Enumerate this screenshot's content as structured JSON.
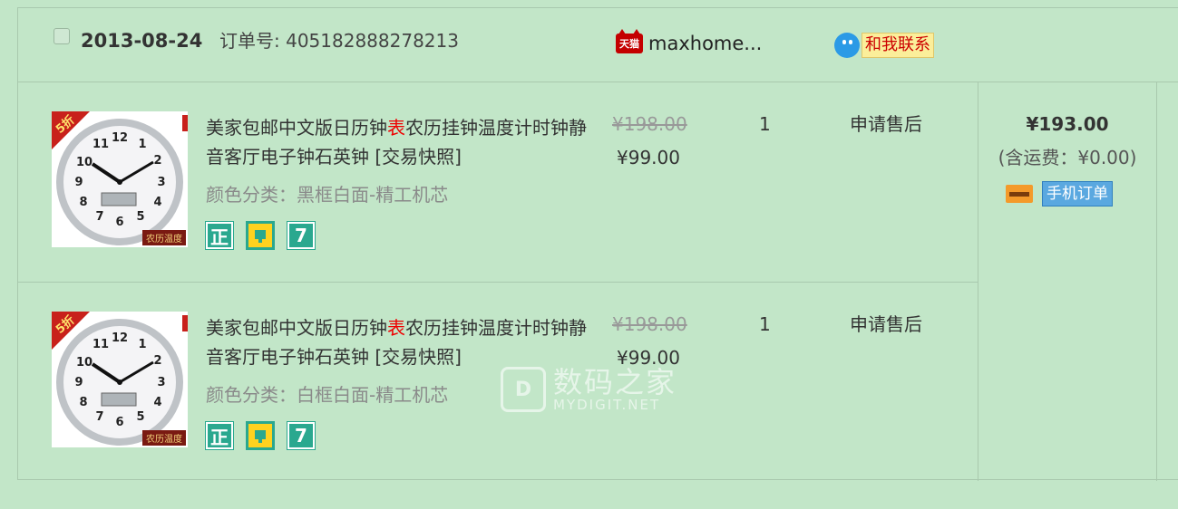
{
  "order": {
    "date": "2013-08-24",
    "order_number": "订单号: 405182888278213",
    "shop_badge": "天猫",
    "shop_name": "maxhome...",
    "contact_label": "和我联系"
  },
  "items": [
    {
      "discount_badge": "5折",
      "thumb_tag": "农历温度",
      "title_before": "美家包邮中文版日历钟",
      "title_highlight": "表",
      "title_after": "农历挂钟温度计时钟静音客厅电子钟石英钟 [交易快照]",
      "sku": "颜色分类：黑框白面-精工机芯",
      "icon1": "正",
      "icon3": "7",
      "original_price": "¥198.00",
      "price": "¥99.00",
      "quantity": "1",
      "after_sale": "申请售后"
    },
    {
      "discount_badge": "5折",
      "thumb_tag": "农历温度",
      "title_before": "美家包邮中文版日历钟",
      "title_highlight": "表",
      "title_after": "农历挂钟温度计时钟静音客厅电子钟石英钟 [交易快照]",
      "sku": "颜色分类：白框白面-精工机芯",
      "icon1": "正",
      "icon3": "7",
      "original_price": "¥198.00",
      "price": "¥99.00",
      "quantity": "1",
      "after_sale": "申请售后"
    }
  ],
  "summary": {
    "total": "¥193.00",
    "shipping": "(含运费：¥0.00)",
    "mobile_order_label": "手机订单"
  },
  "watermark": {
    "cn": "数码之家",
    "en": "MYDIGIT.NET"
  },
  "colors": {
    "background": "#c2e6c8",
    "highlight_red": "#e00000",
    "icon_teal": "#2aa88f"
  }
}
